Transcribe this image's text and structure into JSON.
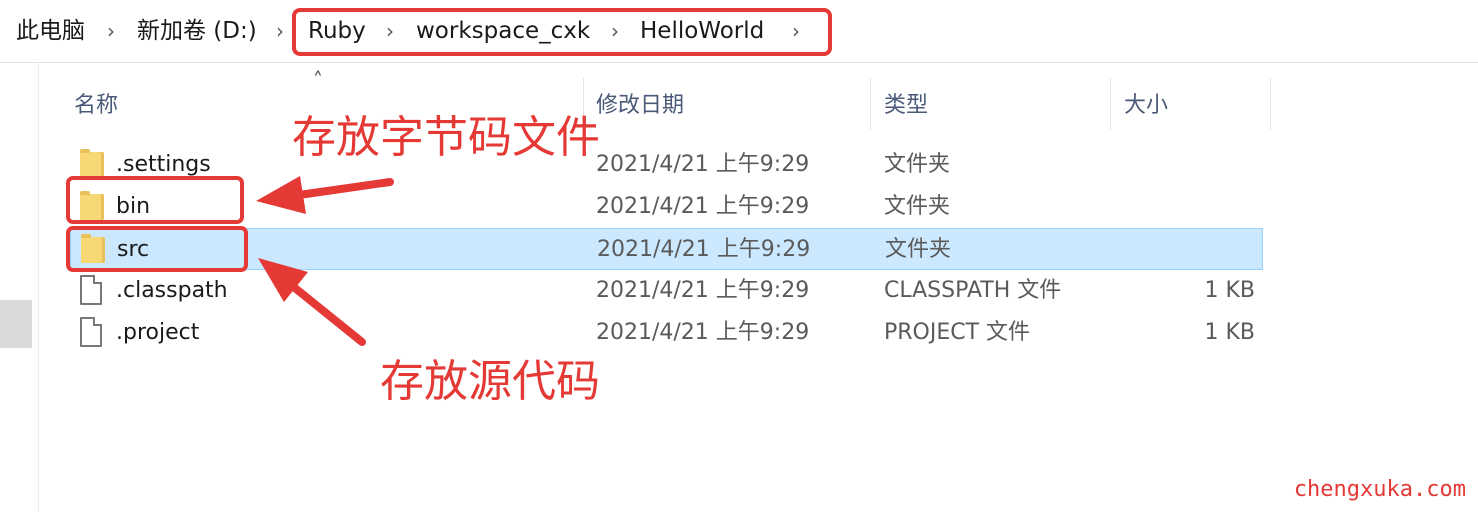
{
  "breadcrumb": [
    "此电脑",
    "新加卷 (D:)",
    "Ruby",
    "workspace_cxk",
    "HelloWorld"
  ],
  "columns": {
    "name": "名称",
    "date": "修改日期",
    "type": "类型",
    "size": "大小"
  },
  "files": [
    {
      "name": ".settings",
      "date": "2021/4/21 上午9:29",
      "type": "文件夹",
      "size": "",
      "icon": "folder-icon"
    },
    {
      "name": "bin",
      "date": "2021/4/21 上午9:29",
      "type": "文件夹",
      "size": "",
      "icon": "folder-icon"
    },
    {
      "name": "src",
      "date": "2021/4/21 上午9:29",
      "type": "文件夹",
      "size": "",
      "icon": "folder-icon"
    },
    {
      "name": ".classpath",
      "date": "2021/4/21 上午9:29",
      "type": "CLASSPATH 文件",
      "size": "1 KB",
      "icon": "file-icon"
    },
    {
      "name": ".project",
      "date": "2021/4/21 上午9:29",
      "type": "PROJECT 文件",
      "size": "1 KB",
      "icon": "file-icon"
    }
  ],
  "annotations": {
    "bytecode": "存放字节码文件",
    "source": "存放源代码",
    "color": "#e53935"
  },
  "watermark": "chengxuka.com"
}
